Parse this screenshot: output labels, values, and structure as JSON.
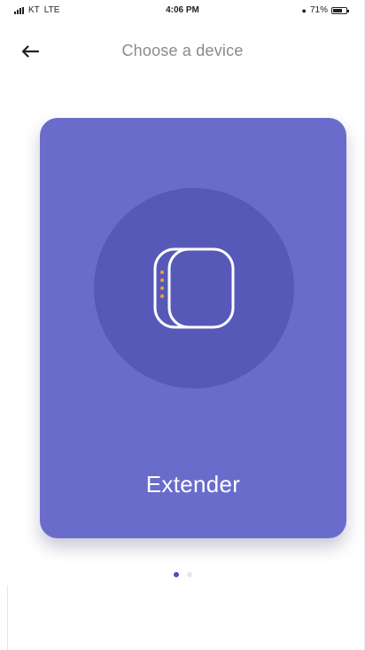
{
  "status_bar": {
    "carrier": "KT",
    "network": "LTE",
    "time": "4:06 PM",
    "battery": "71%",
    "battery_level": 0.71
  },
  "nav": {
    "back_icon": "arrow-left-icon",
    "title": "Choose a device"
  },
  "card": {
    "device_name": "Extender",
    "icon": "extender-device-icon",
    "background_color": "#6a6ccb",
    "circle_color": "#5759b8",
    "indicator_color": "#f0a020"
  },
  "pager": {
    "count": 2,
    "current": 1,
    "active_color": "#4b4dba"
  }
}
